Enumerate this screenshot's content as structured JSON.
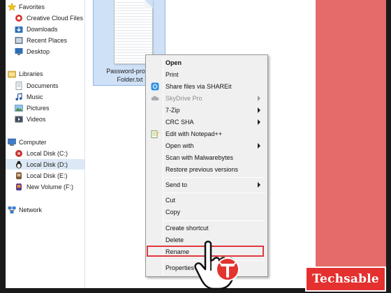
{
  "nav": {
    "favorites": {
      "label": "Favorites"
    },
    "favorite_items": [
      {
        "label": "Creative Cloud Files",
        "icon": "creative-cloud-icon"
      },
      {
        "label": "Downloads",
        "icon": "downloads-folder-icon"
      },
      {
        "label": "Recent Places",
        "icon": "recent-places-icon"
      },
      {
        "label": "Desktop",
        "icon": "desktop-icon"
      }
    ],
    "libraries": {
      "label": "Libraries"
    },
    "library_items": [
      {
        "label": "Documents",
        "icon": "documents-icon"
      },
      {
        "label": "Music",
        "icon": "music-icon"
      },
      {
        "label": "Pictures",
        "icon": "pictures-icon"
      },
      {
        "label": "Videos",
        "icon": "videos-icon"
      }
    ],
    "computer": {
      "label": "Computer"
    },
    "drives": [
      {
        "label": "Local Disk (C:)",
        "icon": "drive-c-icon"
      },
      {
        "label": "Local Disk (D:)",
        "icon": "drive-d-icon",
        "selected": true
      },
      {
        "label": "Local Disk (E:)",
        "icon": "drive-e-icon"
      },
      {
        "label": "New Volume (F:)",
        "icon": "drive-f-icon"
      }
    ],
    "network": {
      "label": "Network"
    }
  },
  "file": {
    "name_line1": "Password-protec",
    "name_line2": "Folder.txt",
    "icon": "text-document-icon"
  },
  "context_menu": {
    "items": [
      {
        "label": "Open",
        "bold": true
      },
      {
        "label": "Print"
      },
      {
        "label": "Share files via SHAREit",
        "icon": "shareit-icon"
      },
      {
        "label": "SkyDrive Pro",
        "icon": "skydrive-icon",
        "disabled": true,
        "submenu": true
      },
      {
        "label": "7-Zip",
        "submenu": true
      },
      {
        "label": "CRC SHA",
        "submenu": true
      },
      {
        "label": "Edit with Notepad++",
        "icon": "notepad-plus-plus-icon"
      },
      {
        "label": "Open with",
        "submenu": true
      },
      {
        "label": "Scan with Malwarebytes"
      },
      {
        "label": "Restore previous versions"
      },
      {
        "label": "Send to",
        "submenu": true
      },
      {
        "label": "Cut"
      },
      {
        "label": "Copy"
      },
      {
        "label": "Create shortcut"
      },
      {
        "label": "Delete"
      },
      {
        "label": "Rename",
        "highlighted": true
      },
      {
        "label": "Properties"
      }
    ]
  },
  "branding": {
    "watermark": "Techsable",
    "accent_color": "#e46b69",
    "badge_color": "#e4302f",
    "highlight_color": "#e0393f"
  }
}
